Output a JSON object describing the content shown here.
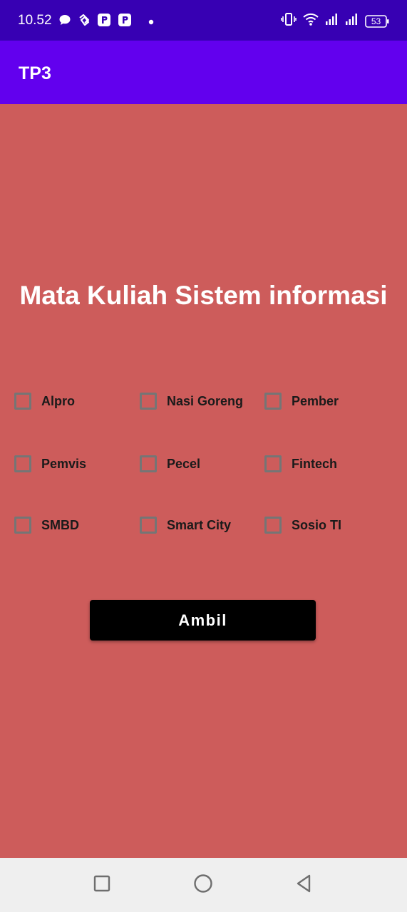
{
  "status_bar": {
    "time": "10.52",
    "battery": "53",
    "left_icons": [
      "chat-icon",
      "link-icon",
      "p-app-icon",
      "p-app-icon",
      "dot-icon"
    ],
    "right_icons": [
      "vibrate-icon",
      "wifi-icon",
      "signal-icon",
      "signal-icon",
      "battery-icon"
    ]
  },
  "app_bar": {
    "title": "TP3"
  },
  "main": {
    "heading": "Mata Kuliah Sistem informasi",
    "checkboxes": [
      {
        "label": "Alpro",
        "checked": false
      },
      {
        "label": "Nasi Goreng",
        "checked": false
      },
      {
        "label": "Pember",
        "checked": false
      },
      {
        "label": "Pemvis",
        "checked": false
      },
      {
        "label": "Pecel",
        "checked": false
      },
      {
        "label": "Fintech",
        "checked": false
      },
      {
        "label": "SMBD",
        "checked": false
      },
      {
        "label": "Smart City",
        "checked": false
      },
      {
        "label": "Sosio TI",
        "checked": false
      }
    ],
    "button_label": "Ambil"
  },
  "nav_bar": {
    "buttons": [
      "recents-icon",
      "home-icon",
      "back-icon"
    ]
  },
  "colors": {
    "status_bar": "#3700b3",
    "app_bar": "#6200ee",
    "background": "#cd5c5b",
    "button": "#000000",
    "nav_bar": "#efefef"
  }
}
